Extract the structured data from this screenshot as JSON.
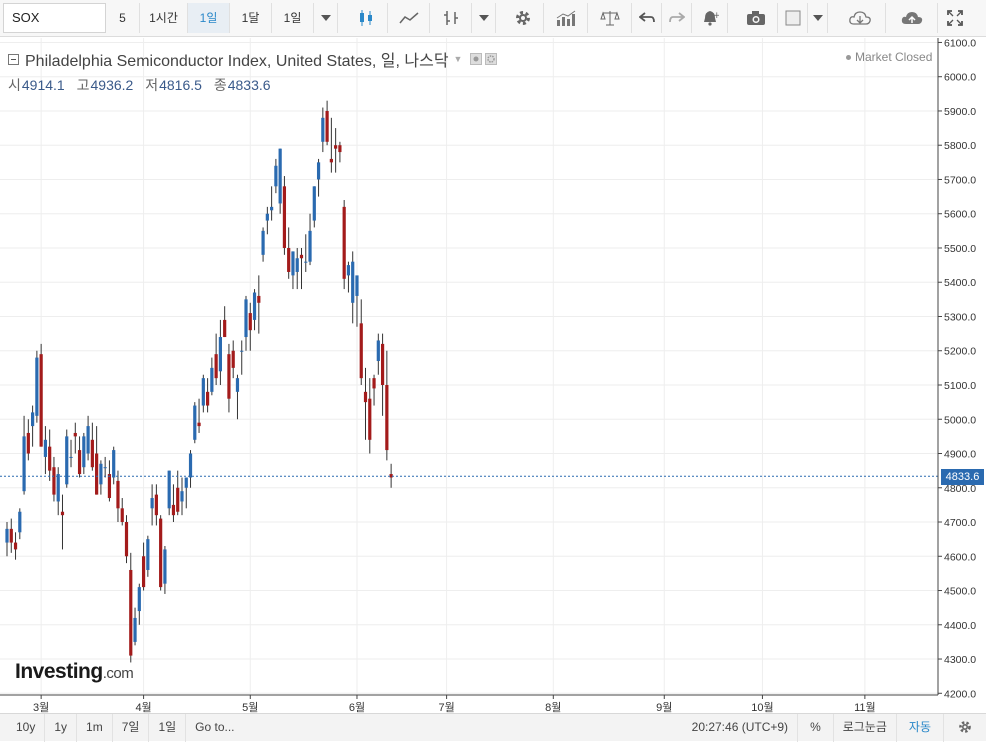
{
  "toolbar": {
    "symbol": "SOX",
    "quick_interval": "5",
    "intervals": [
      "1시간",
      "1일",
      "1달",
      "1일"
    ],
    "active_interval": 1
  },
  "header": {
    "title": "Philadelphia Semiconductor Index, United States, 일, 나스닥",
    "ohlc": [
      {
        "label": "시",
        "value": "4914.1"
      },
      {
        "label": "고",
        "value": "4936.2"
      },
      {
        "label": "저",
        "value": "4816.5"
      },
      {
        "label": "종",
        "value": "4833.6"
      }
    ],
    "market_status": "Market Closed"
  },
  "logo": {
    "main": "Investing",
    "suffix": ".com"
  },
  "last_price_label": "4833.6",
  "colors": {
    "up": "#2a6ab0",
    "down": "#a31b1b",
    "grid": "#eeeeee",
    "last_price_line": "#2a6ab0"
  },
  "bottom": {
    "ranges": [
      "10y",
      "1y",
      "1m",
      "7일",
      "1일",
      "Go to..."
    ],
    "clock": "20:27:46",
    "timezone": "(UTC+9)",
    "percent": "%",
    "log": "로그눈금",
    "auto": "자동"
  },
  "chart_data": {
    "type": "candlestick",
    "x_tick_labels": [
      "3월",
      "4월",
      "5월",
      "6월",
      "7월",
      "8월",
      "9월",
      "10월",
      "11월"
    ],
    "x_tick_index": [
      8,
      32,
      57,
      82,
      103,
      128,
      154,
      177,
      201
    ],
    "y_ticks": [
      4200,
      4300,
      4400,
      4500,
      4600,
      4700,
      4800,
      4900,
      5000,
      5100,
      5200,
      5300,
      5400,
      5500,
      5600,
      5700,
      5800,
      5900,
      6000,
      6100
    ],
    "y_tick_labels": [
      "4200.0",
      "4300.0",
      "4400.0",
      "4500.0",
      "4600.0",
      "4700.0",
      "4800.0",
      "4900.0",
      "5000.0",
      "5100.0",
      "5200.0",
      "5300.0",
      "5400.0",
      "5500.0",
      "5600.0",
      "5700.0",
      "5800.0",
      "5900.0",
      "6000.0",
      "6100.0"
    ],
    "ylim": [
      4200,
      6100
    ],
    "last_price": 4833.6,
    "candles": [
      [
        4640,
        4700,
        4600,
        4680
      ],
      [
        4680,
        4710,
        4610,
        4640
      ],
      [
        4640,
        4670,
        4590,
        4620
      ],
      [
        4670,
        4740,
        4650,
        4730
      ],
      [
        4790,
        5010,
        4780,
        4950
      ],
      [
        4960,
        5000,
        4880,
        4900
      ],
      [
        4980,
        5040,
        4920,
        5020
      ],
      [
        5010,
        5200,
        4990,
        5180
      ],
      [
        5190,
        5220,
        4920,
        4920
      ],
      [
        4890,
        4980,
        4840,
        4940
      ],
      [
        4920,
        4970,
        4820,
        4850
      ],
      [
        4860,
        4890,
        4760,
        4780
      ],
      [
        4760,
        4860,
        4720,
        4840
      ],
      [
        4730,
        4780,
        4620,
        4720
      ],
      [
        4810,
        4970,
        4800,
        4950
      ],
      [
        4890,
        4940,
        4860,
        4890
      ],
      [
        4960,
        4990,
        4900,
        4950
      ],
      [
        4910,
        4950,
        4830,
        4840
      ],
      [
        4860,
        4960,
        4840,
        4950
      ],
      [
        4900,
        5010,
        4880,
        4980
      ],
      [
        4940,
        4990,
        4850,
        4860
      ],
      [
        4900,
        4980,
        4780,
        4780
      ],
      [
        4810,
        4880,
        4780,
        4870
      ],
      [
        4860,
        4890,
        4830,
        4860
      ],
      [
        4840,
        4880,
        4760,
        4770
      ],
      [
        4830,
        4920,
        4810,
        4910
      ],
      [
        4820,
        4850,
        4700,
        4740
      ],
      [
        4740,
        4770,
        4690,
        4700
      ],
      [
        4700,
        4720,
        4580,
        4600
      ],
      [
        4560,
        4610,
        4290,
        4310
      ],
      [
        4350,
        4450,
        4340,
        4420
      ],
      [
        4440,
        4520,
        4400,
        4510
      ],
      [
        4600,
        4640,
        4500,
        4510
      ],
      [
        4560,
        4660,
        4540,
        4650
      ],
      [
        4740,
        4810,
        4690,
        4770
      ],
      [
        4780,
        4810,
        4690,
        4720
      ],
      [
        4710,
        4720,
        4500,
        4510
      ],
      [
        4520,
        4630,
        4490,
        4620
      ],
      [
        4740,
        4850,
        4720,
        4850
      ],
      [
        4750,
        4810,
        4700,
        4720
      ],
      [
        4800,
        4850,
        4720,
        4730
      ],
      [
        4760,
        4830,
        4720,
        4790
      ],
      [
        4800,
        4830,
        4740,
        4830
      ],
      [
        4830,
        4910,
        4800,
        4900
      ],
      [
        4940,
        5050,
        4930,
        5040
      ],
      [
        4990,
        5060,
        4960,
        4980
      ],
      [
        5040,
        5130,
        5020,
        5120
      ],
      [
        5080,
        5120,
        5020,
        5040
      ],
      [
        5080,
        5180,
        5070,
        5150
      ],
      [
        5190,
        5250,
        5100,
        5120
      ],
      [
        5140,
        5290,
        5100,
        5240
      ],
      [
        5290,
        5330,
        5240,
        5240
      ],
      [
        5190,
        5220,
        5020,
        5060
      ],
      [
        5200,
        5230,
        5120,
        5150
      ],
      [
        5080,
        5130,
        5000,
        5120
      ],
      [
        5200,
        5230,
        5130,
        5200
      ],
      [
        5240,
        5360,
        5200,
        5350
      ],
      [
        5310,
        5340,
        5200,
        5260
      ],
      [
        5290,
        5380,
        5260,
        5370
      ],
      [
        5360,
        5420,
        5250,
        5340
      ],
      [
        5480,
        5560,
        5460,
        5550
      ],
      [
        5580,
        5620,
        5540,
        5600
      ],
      [
        5610,
        5680,
        5580,
        5620
      ],
      [
        5680,
        5760,
        5660,
        5740
      ],
      [
        5630,
        5790,
        5600,
        5790
      ],
      [
        5680,
        5710,
        5480,
        5500
      ],
      [
        5500,
        5560,
        5410,
        5430
      ],
      [
        5420,
        5490,
        5380,
        5490
      ],
      [
        5430,
        5500,
        5380,
        5470
      ],
      [
        5480,
        5500,
        5380,
        5470
      ],
      [
        5460,
        5540,
        5430,
        5460
      ],
      [
        5460,
        5600,
        5450,
        5550
      ],
      [
        5580,
        5680,
        5560,
        5680
      ],
      [
        5700,
        5760,
        5650,
        5750
      ],
      [
        5810,
        5910,
        5780,
        5880
      ],
      [
        5900,
        5930,
        5800,
        5810
      ],
      [
        5760,
        5880,
        5720,
        5750
      ],
      [
        5800,
        5850,
        5720,
        5790
      ],
      [
        5800,
        5810,
        5750,
        5780
      ],
      [
        5620,
        5640,
        5380,
        5410
      ],
      [
        5420,
        5460,
        5370,
        5450
      ],
      [
        5340,
        5490,
        5280,
        5460
      ],
      [
        5360,
        5400,
        5270,
        5420
      ],
      [
        5280,
        5350,
        5100,
        5120
      ],
      [
        5080,
        5150,
        4940,
        5050
      ],
      [
        5060,
        5120,
        4900,
        4940
      ],
      [
        5120,
        5130,
        5040,
        5090
      ],
      [
        5170,
        5250,
        5130,
        5230
      ],
      [
        5220,
        5250,
        5010,
        5100
      ],
      [
        5100,
        5200,
        4880,
        4910
      ],
      [
        4840,
        4870,
        4800,
        4830
      ]
    ]
  }
}
